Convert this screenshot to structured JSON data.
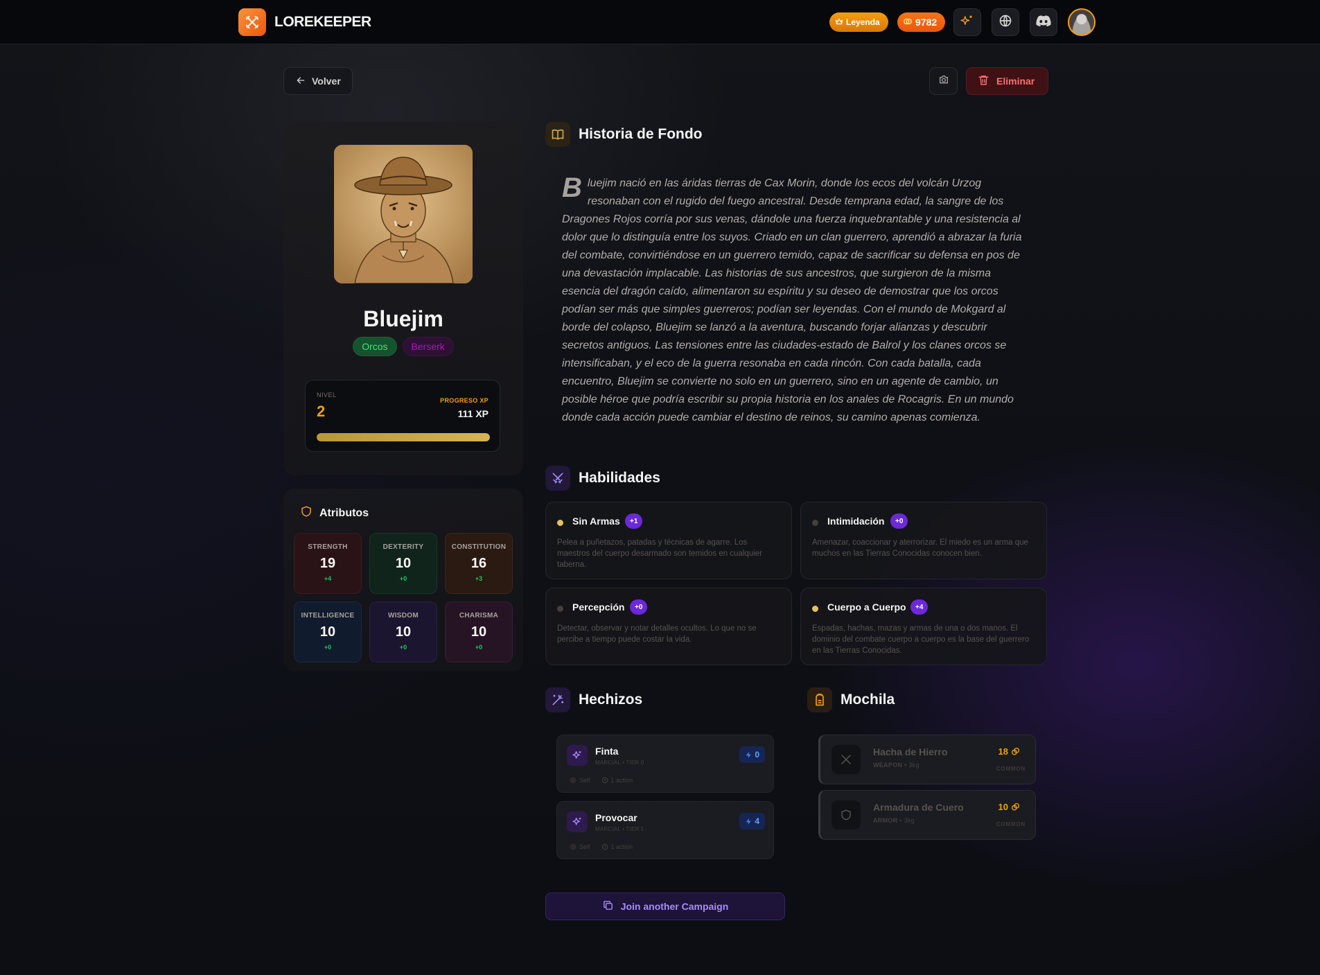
{
  "app": {
    "name": "LOREKEEPER"
  },
  "header": {
    "tier_label": "Leyenda",
    "coins": "9782"
  },
  "toolbar": {
    "back_label": "Volver",
    "delete_label": "Eliminar"
  },
  "character": {
    "name": "Bluejim",
    "race": "Orcos",
    "class": "Berserk",
    "level_label": "NIVEL",
    "level": "2",
    "xp_label": "PROGRESO XP",
    "xp": "111 XP",
    "xp_progress": 1.0
  },
  "attributes": {
    "title": "Atributos",
    "items": [
      {
        "name": "STRENGTH",
        "value": "19",
        "mod": "+4"
      },
      {
        "name": "DEXTERITY",
        "value": "10",
        "mod": "+0"
      },
      {
        "name": "CONSTITUTION",
        "value": "16",
        "mod": "+3"
      },
      {
        "name": "INTELLIGENCE",
        "value": "10",
        "mod": "+0"
      },
      {
        "name": "WISDOM",
        "value": "10",
        "mod": "+0"
      },
      {
        "name": "CHARISMA",
        "value": "10",
        "mod": "+0"
      }
    ]
  },
  "backstory": {
    "title": "Historia de Fondo",
    "dropcap": "B",
    "text": "luejim nació en las áridas tierras de Cax Morin, donde los ecos del volcán Urzog resonaban con el rugido del fuego ancestral. Desde temprana edad, la sangre de los Dragones Rojos corría por sus venas, dándole una fuerza inquebrantable y una resistencia al dolor que lo distinguía entre los suyos. Criado en un clan guerrero, aprendió a abrazar la furia del combate, convirtiéndose en un guerrero temido, capaz de sacrificar su defensa en pos de una devastación implacable. Las historias de sus ancestros, que surgieron de la misma esencia del dragón caído, alimentaron su espíritu y su deseo de demostrar que los orcos podían ser más que simples guerreros; podían ser leyendas. Con el mundo de Mokgard al borde del colapso, Bluejim se lanzó a la aventura, buscando forjar alianzas y descubrir secretos antiguos. Las tensiones entre las ciudades-estado de Balrol y los clanes orcos se intensificaban, y el eco de la guerra resonaba en cada rincón. Con cada batalla, cada encuentro, Bluejim se convierte no solo en un guerrero, sino en un agente de cambio, un posible héroe que podría escribir su propia historia en los anales de Rocagris. En un mundo donde cada acción puede cambiar el destino de reinos, su camino apenas comienza."
  },
  "skills": {
    "title": "Habilidades",
    "items": [
      {
        "name": "Sin Armas",
        "bonus": "+1",
        "trained": true,
        "desc": "Pelea a puñetazos, patadas y técnicas de agarre. Los maestros del cuerpo desarmado son temidos en cualquier taberna."
      },
      {
        "name": "Intimidación",
        "bonus": "+0",
        "trained": false,
        "desc": "Amenazar, coaccionar y aterrorizar. El miedo es un arma que muchos en las Tierras Conocidas conocen bien."
      },
      {
        "name": "Percepción",
        "bonus": "+0",
        "trained": false,
        "desc": "Detectar, observar y notar detalles ocultos. Lo que no se percibe a tiempo puede costar la vida."
      },
      {
        "name": "Cuerpo a Cuerpo",
        "bonus": "+4",
        "trained": true,
        "desc": "Espadas, hachas, mazas y armas de una o dos manos. El dominio del combate cuerpo a cuerpo es la base del guerrero en las Tierras Conocidas."
      }
    ]
  },
  "spells": {
    "title": "Hechizos",
    "items": [
      {
        "name": "Finta",
        "meta": "MARCIAL • TIER 0",
        "range": "Self",
        "time": "1 action",
        "cost": "0"
      },
      {
        "name": "Provocar",
        "meta": "MARCIAL • TIER 1",
        "range": "Self",
        "time": "1 action",
        "cost": "4"
      }
    ]
  },
  "backpack": {
    "title": "Mochila",
    "items": [
      {
        "name": "Hacha de Hierro",
        "type": "WEAPON",
        "weight": "• 3kg",
        "value": "18",
        "rarity": "COMMON",
        "icon": "axe-icon"
      },
      {
        "name": "Armadura de Cuero",
        "type": "ARMOR",
        "weight": "• 3kg",
        "value": "10",
        "rarity": "COMMON",
        "icon": "shield-icon"
      }
    ]
  },
  "join_label": "Join another Campaign",
  "colors": {
    "accent": "#f59e0b",
    "brand": "#f97316",
    "purple": "#7c3aed",
    "danger": "#f87171"
  }
}
